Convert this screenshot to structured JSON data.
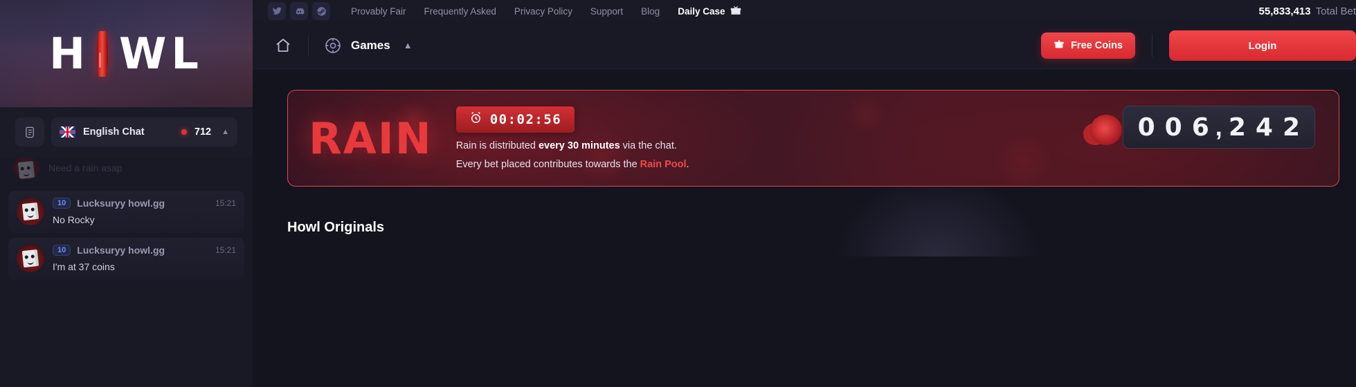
{
  "sidebar": {
    "logo": {
      "left": "H",
      "right": "WL",
      "coin_icon": "red-coin-icon"
    },
    "chat": {
      "scroll_icon": "scroll-document-icon",
      "flag_icon": "uk-flag-icon",
      "language_label": "English Chat",
      "online_count": "712",
      "collapse_icon": "chevron-up-icon",
      "faded_message": "Need a rain asap",
      "messages": [
        {
          "level": "10",
          "username": "Lucksuryy howl.gg",
          "time": "15:21",
          "text": "No Rocky",
          "avatar_icon": "paper-bag-avatar"
        },
        {
          "level": "10",
          "username": "Lucksuryy howl.gg",
          "time": "15:21",
          "text": "I'm at 37 coins",
          "avatar_icon": "paper-bag-avatar"
        }
      ]
    }
  },
  "topbar": {
    "social": [
      {
        "name": "twitter-icon",
        "glyph": "twitter"
      },
      {
        "name": "discord-icon",
        "glyph": "discord"
      },
      {
        "name": "steam-icon",
        "glyph": "steam"
      }
    ],
    "links": [
      {
        "label": "Provably Fair",
        "active": false
      },
      {
        "label": "Frequently Asked",
        "active": false
      },
      {
        "label": "Privacy Policy",
        "active": false
      },
      {
        "label": "Support",
        "active": false
      },
      {
        "label": "Blog",
        "active": false
      },
      {
        "label": "Daily Case",
        "active": true,
        "icon": "gift-box-icon"
      }
    ],
    "total_bets_number": "55,833,413",
    "total_bets_label": "Total Bet"
  },
  "navbar": {
    "home_icon": "home-icon",
    "games_icon": "games-target-icon",
    "games_label": "Games",
    "games_chevron": "chevron-up-icon",
    "free_coins_label": "Free Coins",
    "free_coins_icon": "gift-icon",
    "login_label": "Login"
  },
  "rain": {
    "title": "RAIN",
    "timer_icon": "alarm-clock-icon",
    "timer": "00:02:56",
    "line1_pre": "Rain is distributed ",
    "line1_bold": "every 30 minutes",
    "line1_post": " via the chat.",
    "line2_pre": "Every bet placed contributes towards the ",
    "line2_link": "Rain Pool",
    "line2_post": ".",
    "pool_digits": [
      "0",
      "0",
      "6",
      ",",
      "2",
      "4",
      "2"
    ],
    "chips_icon": "poker-chips-icon"
  },
  "main": {
    "section_title": "Howl Originals"
  }
}
